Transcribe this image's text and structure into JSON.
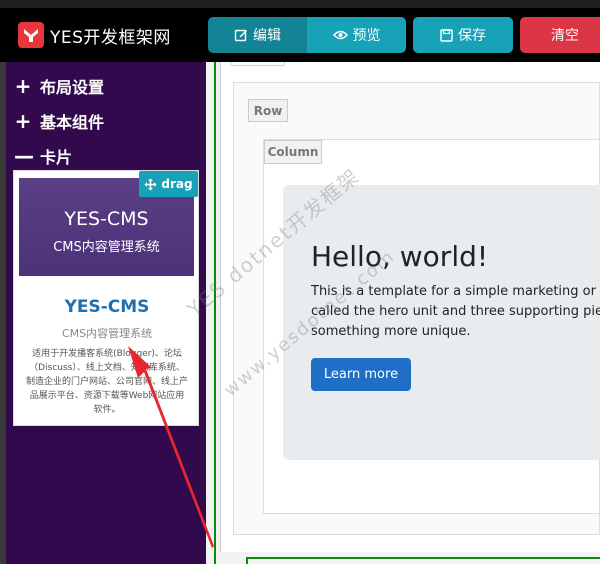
{
  "app": {
    "title": "YES开发框架网"
  },
  "toolbar": {
    "edit_label": "编辑",
    "preview_label": "预览",
    "save_label": "保存",
    "clear_label": "清空"
  },
  "sidebar": {
    "items": [
      {
        "symbol": "+",
        "label": "布局设置"
      },
      {
        "symbol": "+",
        "label": "基本组件"
      },
      {
        "symbol": "—",
        "label": "卡片"
      }
    ]
  },
  "card": {
    "banner_title": "YES-CMS",
    "banner_subtitle": "CMS内容管理系统",
    "title": "YES-CMS",
    "subtitle": "CMS内容管理系统",
    "description": "适用于开发播客系统(Blogger)、论坛（Discuss）、线上文档、知识库系统、制造企业的门户网站、公司官网、线上产品展示平台、资源下载等Web网站应用软件。",
    "drag_label": "drag"
  },
  "canvas": {
    "row_label": "Row",
    "column_label": "Column",
    "hero": {
      "title": "Hello, world!",
      "lines": [
        "This is a template for a simple marketing or info",
        "called the hero unit and three supporting piece",
        "something more unique."
      ],
      "button_label": "Learn more"
    }
  },
  "watermark": {
    "line1": "YES dotnet开发框架",
    "line2": "www.yesdotnet.com"
  },
  "colors": {
    "sidebar_bg": "#33094d",
    "info": "#17a2b8",
    "info_dark": "#138496",
    "danger": "#dc3545",
    "primary": "#1f6fc7",
    "annotation_arrow": "#e8262e"
  }
}
